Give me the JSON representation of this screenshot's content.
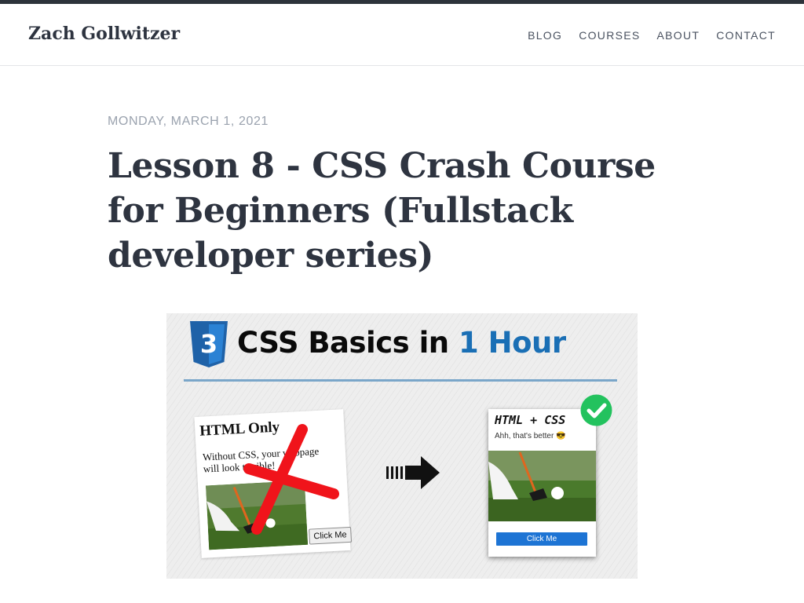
{
  "header": {
    "brand": "Zach Gollwitzer",
    "nav": [
      {
        "label": "BLOG"
      },
      {
        "label": "COURSES"
      },
      {
        "label": "ABOUT"
      },
      {
        "label": "CONTACT"
      }
    ]
  },
  "post": {
    "date": "MONDAY, MARCH 1, 2021",
    "title": "Lesson 8 - CSS Crash Course for Beginners (Fullstack developer series)"
  },
  "hero": {
    "heading_main": "CSS Basics in ",
    "heading_accent": "1 Hour",
    "logo_icon": "css3-logo-icon",
    "left_card": {
      "title": "HTML Only",
      "text": "Without CSS, your webpage will look terrible!",
      "button": "Click Me"
    },
    "right_card": {
      "title": "HTML + CSS",
      "text": "Ahh, that's better 😎",
      "button": "Click Me"
    },
    "colors": {
      "accent_blue": "#1a6fb5",
      "red_x": "#f0141b",
      "check_green": "#23c25e",
      "button_blue": "#1d74d4"
    }
  }
}
